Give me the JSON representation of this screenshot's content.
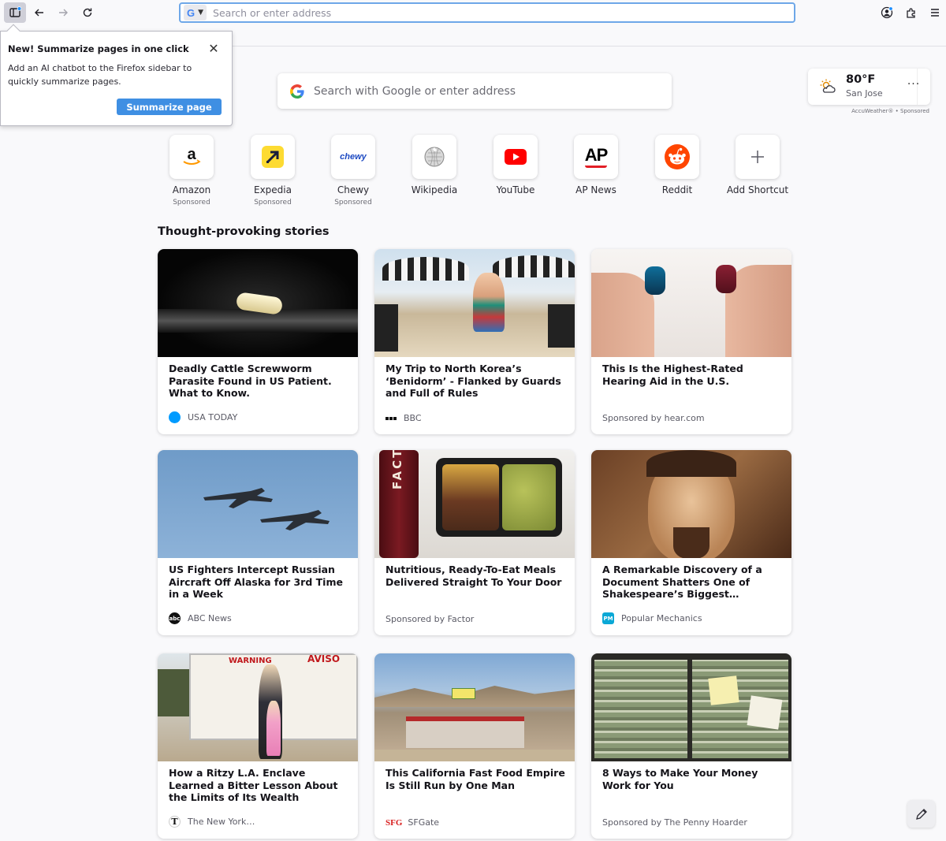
{
  "browser": {
    "sidebar_icon": "sidebar-icon",
    "back_icon": "back-arrow-icon",
    "forward_icon": "forward-arrow-icon",
    "reload_icon": "reload-icon",
    "engine_letter": "G",
    "url_placeholder": "Search or enter address",
    "account_icon": "account-icon",
    "extensions_icon": "extensions-icon",
    "menu_icon": "hamburger-menu-icon"
  },
  "callout": {
    "title": "New! Summarize pages in one click",
    "body": "Add an AI chatbot to the Firefox sidebar to quickly summarize pages.",
    "button": "Summarize page"
  },
  "search": {
    "placeholder": "Search with Google or enter address"
  },
  "weather": {
    "temp": "80°F",
    "city": "San Jose",
    "sponsor": "AccuWeather® • Sponsored"
  },
  "shortcuts": [
    {
      "label": "Amazon",
      "sponsor": "Sponsored"
    },
    {
      "label": "Expedia",
      "sponsor": "Sponsored"
    },
    {
      "label": "Chewy",
      "sponsor": "Sponsored"
    },
    {
      "label": "Wikipedia",
      "sponsor": ""
    },
    {
      "label": "YouTube",
      "sponsor": ""
    },
    {
      "label": "AP News",
      "sponsor": ""
    },
    {
      "label": "Reddit",
      "sponsor": ""
    },
    {
      "label": "Add Shortcut",
      "sponsor": ""
    }
  ],
  "shortcut_logos": {
    "chewy": "chewy",
    "ap": "AP",
    "amazon": "a"
  },
  "stories_title": "Thought-provoking stories",
  "stories": [
    {
      "title": "Deadly Cattle Screwworm Parasite Found in US Patient. What to Know.",
      "source": "USA TODAY"
    },
    {
      "title": "My Trip to North Korea’s ‘Benidorm’ - Flanked by Guards and Full of Rules",
      "source": "BBC"
    },
    {
      "title": "This Is the Highest-Rated Hearing Aid in the U.S.",
      "source": "Sponsored by hear.com"
    },
    {
      "title": "US Fighters Intercept Russian Aircraft Off Alaska for 3rd Time in a Week",
      "source": "ABC News"
    },
    {
      "title": "Nutritious, Ready-To-Eat Meals Delivered Straight To Your Door",
      "source": "Sponsored by Factor"
    },
    {
      "title": "A Remarkable Discovery of a Document Shatters One of Shakespeare’s Biggest…",
      "source": "Popular Mechanics"
    },
    {
      "title": "How a Ritzy L.A. Enclave Learned a Bitter Lesson About the Limits of Its Wealth",
      "source": "The New York…"
    },
    {
      "title": "This California Fast Food Empire Is Still Run by One Man",
      "source": "SFGate"
    },
    {
      "title": "8 Ways to Make Your Money Work for You",
      "source": "Sponsored by The Penny Hoarder"
    }
  ],
  "image_text": {
    "factor": "FACTOR",
    "warning": "WARNING",
    "aviso": "AVISO"
  },
  "source_icons": {
    "mic": "PM",
    "sfg": "SFG",
    "nyt": "T"
  },
  "colors": {
    "accent": "#3f8fe3",
    "urlbar_border": "#6ea7e8"
  }
}
